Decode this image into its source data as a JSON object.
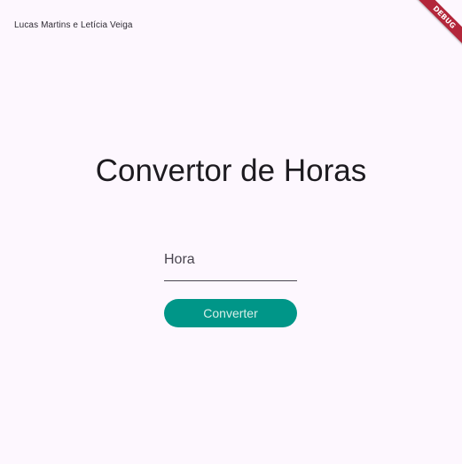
{
  "header": {
    "authors": "Lucas Martins e Letícia Veiga"
  },
  "main": {
    "title": "Convertor de Horas",
    "hour_field": {
      "placeholder": "Hora",
      "value": ""
    },
    "convert_button_label": "Converter"
  },
  "debug_banner": {
    "label": "DEBUG"
  },
  "colors": {
    "background": "#fdf7fe",
    "button": "#009688",
    "debug_ribbon": "#b3263a"
  }
}
